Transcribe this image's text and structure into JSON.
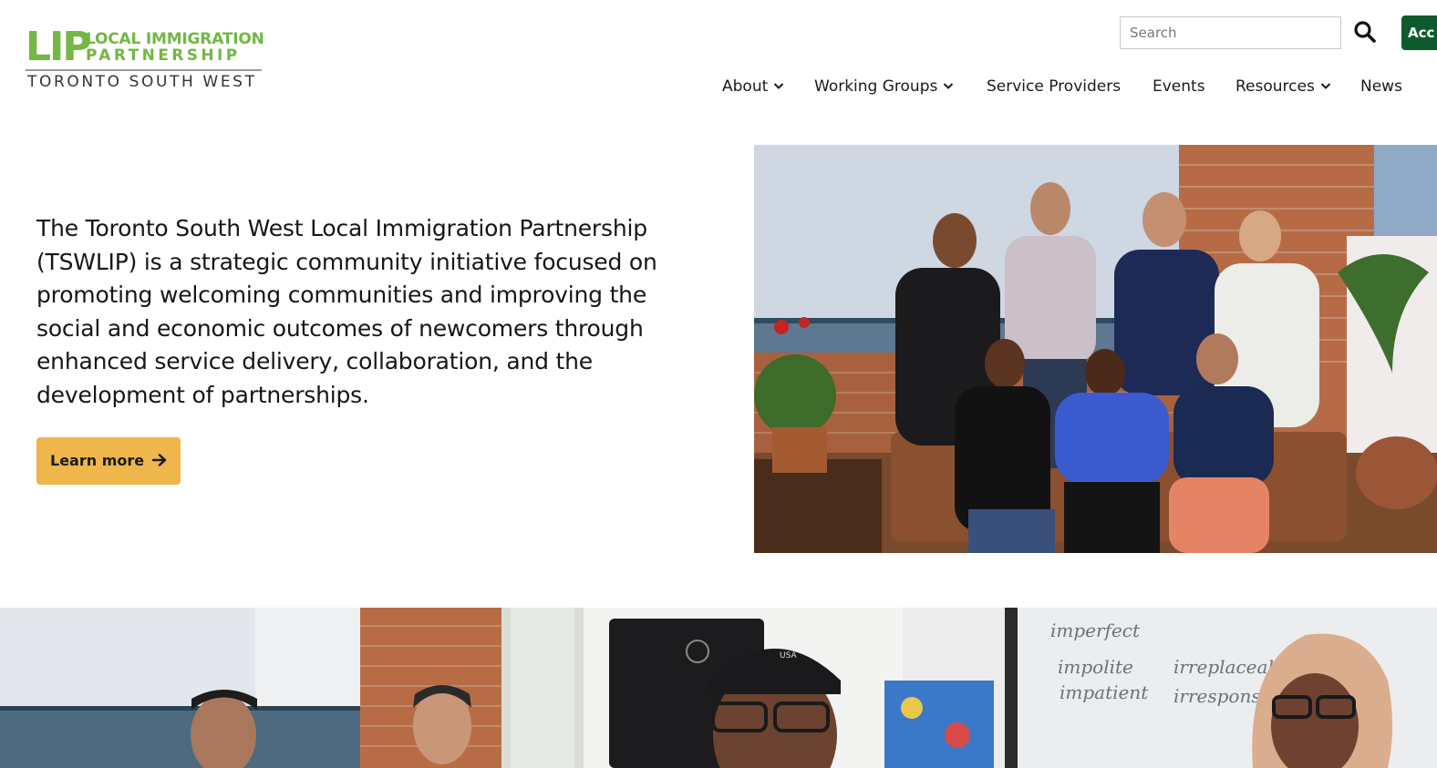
{
  "brand": {
    "logo_mark": "LIP",
    "logo_line1": "LOCAL IMMIGRATION",
    "logo_line2": "PARTNERSHIP",
    "logo_line3": "TORONTO SOUTH WEST",
    "color_green": "#73b744",
    "color_dark_green": "#0e5a2e"
  },
  "search": {
    "placeholder": "Search",
    "icon": "search-icon"
  },
  "account": {
    "label": "Acc"
  },
  "nav": {
    "items": [
      {
        "label": "About",
        "has_dropdown": true
      },
      {
        "label": "Working Groups",
        "has_dropdown": true
      },
      {
        "label": "Service Providers",
        "has_dropdown": false
      },
      {
        "label": "Events",
        "has_dropdown": false
      },
      {
        "label": "Resources",
        "has_dropdown": true
      },
      {
        "label": "News",
        "has_dropdown": false
      }
    ]
  },
  "hero": {
    "description": "The Toronto South West Local Immigration Partnership (TSWLIP) is a strategic community initiative focused on promoting welcoming communities and improving the social and economic outcomes of newcomers through enhanced service delivery, collaboration, and the development of partnerships.",
    "cta_label": "Learn more",
    "cta_icon": "arrow-right-icon",
    "cta_color": "#efb64b"
  },
  "photo_text": {
    "board_word_1": "imperfect",
    "board_word_2": "impolite",
    "board_word_3": "impatient",
    "board_word_4": "irreplaceable",
    "board_word_5": "irresponsible",
    "cap_text": "USA"
  }
}
